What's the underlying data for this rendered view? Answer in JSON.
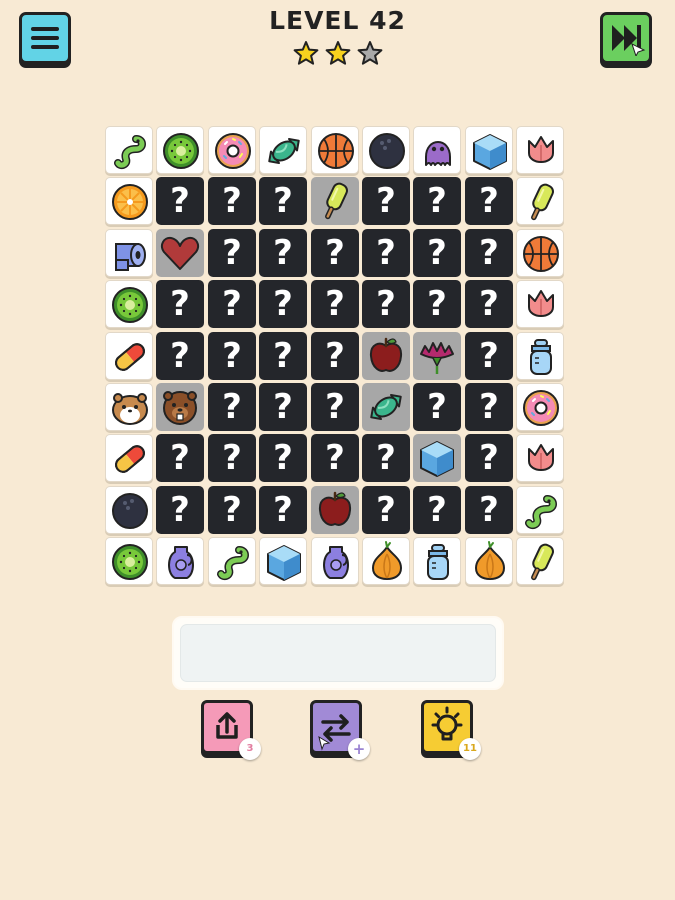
{
  "header": {
    "title": "LEVEL 42",
    "stars_earned": 2,
    "stars_total": 3,
    "menu_icon": "hamburger-menu-icon",
    "skip_icon": "skip-level-icon"
  },
  "board": {
    "columns": 9,
    "rows": 9,
    "hidden_symbol": "?",
    "tiles": [
      [
        "worm",
        "kiwi",
        "donut",
        "candy",
        "basketball",
        "bowling-ball",
        "octopus",
        "ice-cube",
        "tulip"
      ],
      [
        "orange-slice",
        "?",
        "?",
        "?",
        "popsicle",
        "?",
        "?",
        "?",
        "popsicle"
      ],
      [
        "toilet-paper",
        "heart",
        "?",
        "?",
        "?",
        "?",
        "?",
        "?",
        "basketball"
      ],
      [
        "kiwi",
        "?",
        "?",
        "?",
        "?",
        "?",
        "?",
        "?",
        "tulip"
      ],
      [
        "pill",
        "?",
        "?",
        "?",
        "?",
        "apple",
        "carnation",
        "?",
        "baby-bottle"
      ],
      [
        "hamster",
        "beaver",
        "?",
        "?",
        "?",
        "candy",
        "?",
        "?",
        "donut"
      ],
      [
        "pill",
        "?",
        "?",
        "?",
        "?",
        "?",
        "ice-cube",
        "?",
        "tulip"
      ],
      [
        "bowling-ball",
        "?",
        "?",
        "?",
        "apple",
        "?",
        "?",
        "?",
        "worm"
      ],
      [
        "kiwi",
        "vase",
        "worm",
        "ice-cube",
        "vase",
        "onion",
        "baby-bottle",
        "onion",
        "popsicle"
      ]
    ]
  },
  "tray": {
    "slots_used": 0
  },
  "powerups": {
    "undo": {
      "icon": "undo-icon",
      "count": "3"
    },
    "shuffle": {
      "icon": "shuffle-icon",
      "count": "+"
    },
    "hint": {
      "icon": "lightbulb-icon",
      "count": "11"
    }
  },
  "colors": {
    "background": "#f8ead4",
    "menu_button": "#62d3e6",
    "skip_button": "#6bcf5f",
    "undo_button": "#f59ab8",
    "shuffle_button": "#a18ad6",
    "hint_button": "#f6cc33",
    "hidden_tile": "#24262b",
    "star_filled": "#f7d21e",
    "star_empty": "#a9a9a9"
  }
}
